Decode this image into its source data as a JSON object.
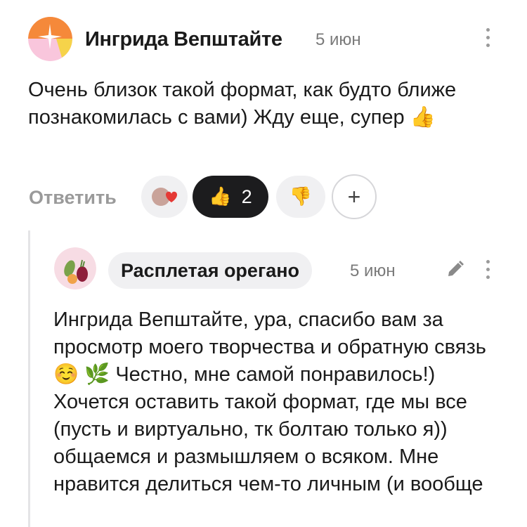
{
  "comment": {
    "author": "Ингрида Вепштайте",
    "date": "5 июн",
    "text": "Очень близок такой формат, как будто ближе познакомилась с вами) Жду еще, супер 👍",
    "actions": {
      "reply_label": "Ответить",
      "like_count": "2",
      "add_reaction_label": "+"
    }
  },
  "reply": {
    "author": "Расплетая орегано",
    "date": "5 июн",
    "text": "Ингрида Вепштайте, ура, спасибо вам за просмотр моего творчества и обратную связь ☺️ 🌿 Честно, мне самой понравилось!) Хочется оставить такой формат, где мы все (пусть и виртуально, тк болтаю только я)) общаемся и размышляем о всяком. Мне нравится делиться чем-то личным (и вообще"
  },
  "colors": {
    "accent_dark": "#1c1c1e",
    "muted_text": "#9a9a9a",
    "chip_bg": "#f0f0f2"
  }
}
